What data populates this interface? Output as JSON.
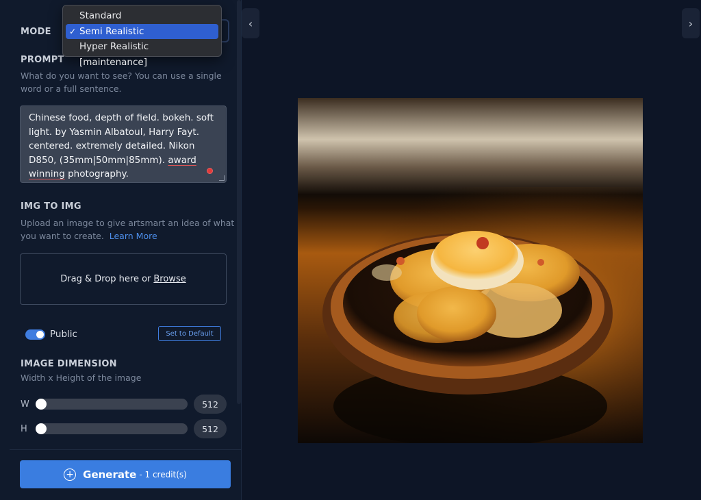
{
  "mode": {
    "label": "MODE",
    "options": [
      "Standard",
      "Semi Realistic",
      "Hyper Realistic [maintenance]"
    ],
    "selected": "Semi Realistic",
    "check_glyph": "✓"
  },
  "prompt": {
    "label": "PROMPT",
    "help_line1": "What do you want to see? You can use a single",
    "help_line2": "word or a full sentence.",
    "line1": "Chinese food, depth of field. bokeh. soft",
    "line2": "light. by Yasmin Albatoul, Harry Fayt.",
    "line3": "centered. extremely detailed. Nikon",
    "line4a": "D850, (35mm|50mm|85mm). ",
    "line4b": "award",
    "line5a": "winning",
    "line5b": " photography."
  },
  "img_to_img": {
    "label": "IMG TO IMG",
    "help_line1": "Upload an image to give artsmart an idea of what",
    "help_line2": "you want to create.",
    "learn_more": "Learn More",
    "drop_text": "Drag & Drop here or",
    "browse": "Browse"
  },
  "visibility": {
    "public_label": "Public",
    "public_on": true,
    "default_button": "Set to Default"
  },
  "dimension": {
    "label": "IMAGE DIMENSION",
    "help": "Width x Height of the image",
    "w_label": "W",
    "h_label": "H",
    "width": "512",
    "height": "512"
  },
  "generate": {
    "label": "Generate",
    "credit": "- 1 credit(s)",
    "icon": "plus-circle-icon"
  },
  "nav": {
    "left_icon": "chevron-left-icon",
    "right_icon": "chevron-right-icon",
    "left_glyph": "‹",
    "right_glyph": "›"
  },
  "colors": {
    "accent": "#3a7de0",
    "background": "#0d1526",
    "panel": "#101a2c"
  }
}
